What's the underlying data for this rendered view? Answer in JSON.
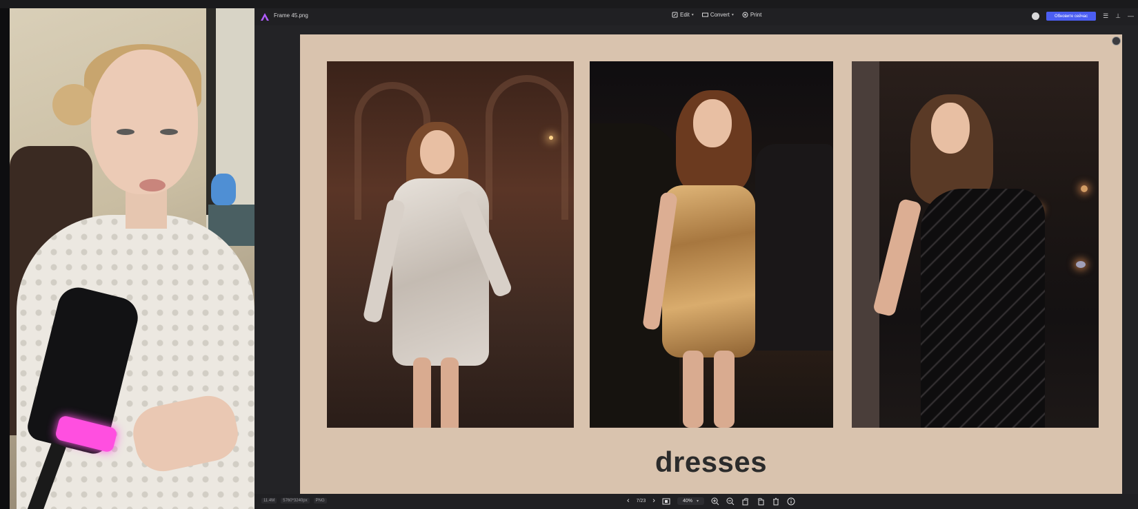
{
  "window": {
    "file_name": "Frame 45.png",
    "toolbar": {
      "edit_label": "Edit",
      "convert_label": "Convert",
      "print_label": "Print"
    },
    "update_button_label": "Обновите сейчас"
  },
  "slide": {
    "caption": "dresses",
    "background_color": "#d9c3ae"
  },
  "statusbar": {
    "file_size": "11.4M",
    "dimensions": "5760*3240px",
    "format": "PNG",
    "page_indicator": "7/23",
    "zoom": "40%"
  },
  "colors": {
    "accent": "#4b5ef2",
    "mic_ring": "#ff4fe0",
    "viewer_bg": "#232326"
  },
  "icons": {
    "app_logo": "app-logo-icon",
    "edit": "edit-icon",
    "convert": "convert-icon",
    "print": "print-icon",
    "menu": "hamburger-icon",
    "pin": "pin-icon",
    "minimize": "minimize-icon",
    "expand": "fullscreen-icon",
    "prev": "chevron-left-icon",
    "next": "chevron-right-icon",
    "fit": "fit-screen-icon",
    "zoom_in": "zoom-in-icon",
    "zoom_out": "zoom-out-icon",
    "rotate_left": "rotate-left-icon",
    "rotate_right": "rotate-right-icon",
    "delete": "trash-icon",
    "info": "info-icon"
  }
}
